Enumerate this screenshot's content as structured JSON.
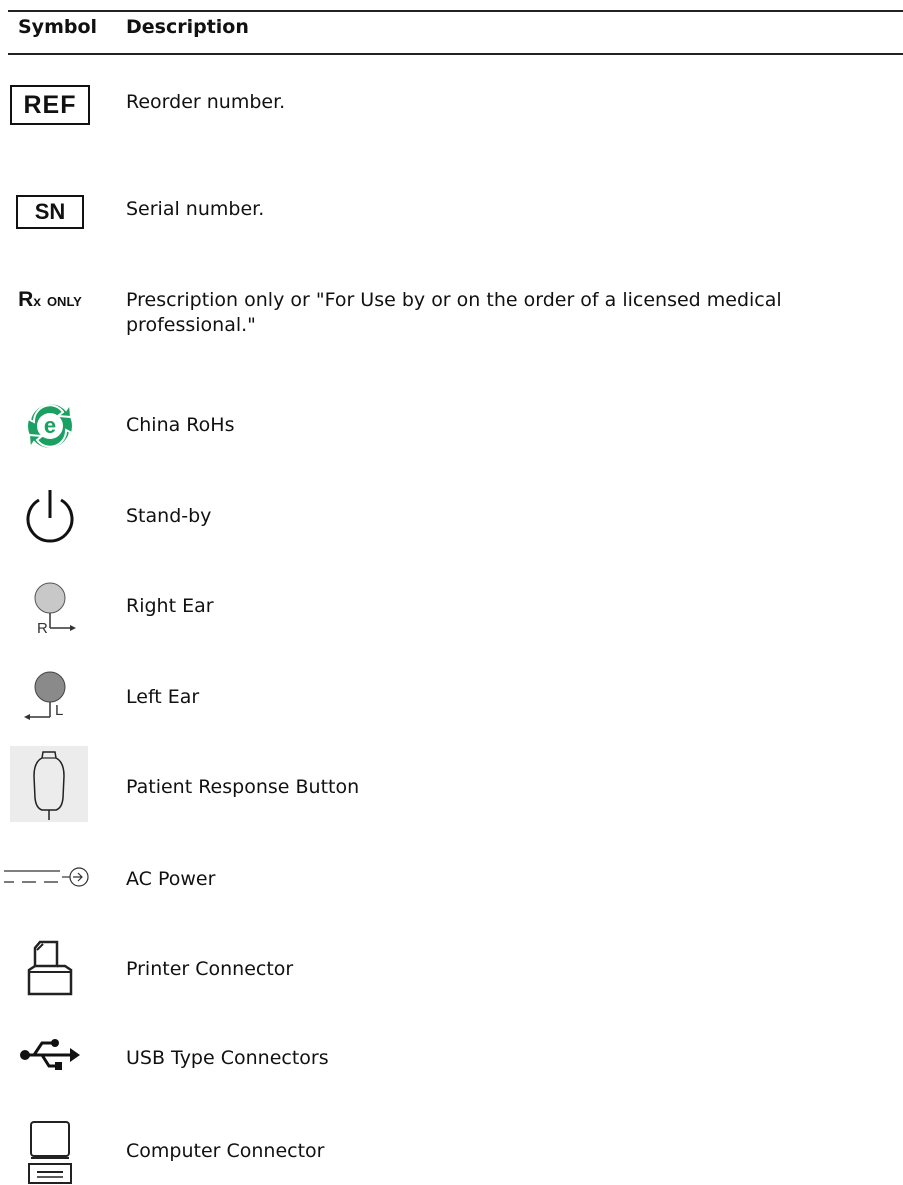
{
  "table": {
    "headers": {
      "symbol": "Symbol",
      "description": "Description"
    },
    "rows": [
      {
        "icon": "ref-icon",
        "icon_text": "REF",
        "description": "Reorder number."
      },
      {
        "icon": "serial-number-icon",
        "icon_text": "SN",
        "description": "Serial number."
      },
      {
        "icon": "rx-only-icon",
        "icon_text_main": "R",
        "icon_text_sub": "x",
        "icon_text_tail": "ONLY",
        "description": "Prescription only or \"For Use by or on the order of a licensed medical professional.\""
      },
      {
        "icon": "china-rohs-icon",
        "icon_color": "#1aa062",
        "description": "China RoHs"
      },
      {
        "icon": "standby-icon",
        "description": "Stand-by"
      },
      {
        "icon": "right-ear-icon",
        "icon_letter": "R",
        "icon_color": "#c8c8c8",
        "description": "Right Ear"
      },
      {
        "icon": "left-ear-icon",
        "icon_letter": "L",
        "icon_color": "#8a8a8a",
        "description": "Left Ear"
      },
      {
        "icon": "patient-response-button-icon",
        "description": "Patient Response Button"
      },
      {
        "icon": "ac-power-icon",
        "description": "AC Power"
      },
      {
        "icon": "printer-connector-icon",
        "description": "Printer Connector"
      },
      {
        "icon": "usb-icon",
        "description": "USB Type Connectors"
      },
      {
        "icon": "computer-connector-icon",
        "description": "Computer Connector"
      }
    ]
  }
}
